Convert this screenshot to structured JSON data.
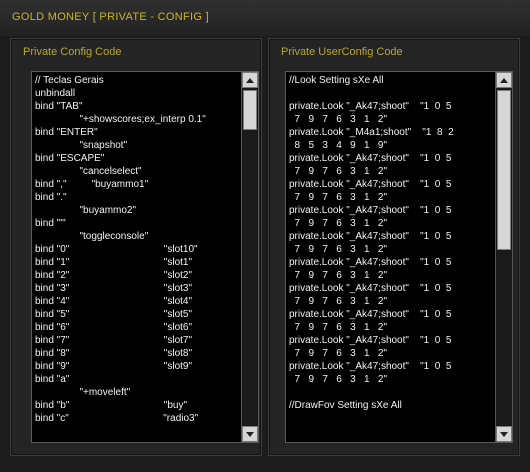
{
  "window": {
    "title": "GOLD MONEY [ PRIVATE - CONFIG ]"
  },
  "left_panel": {
    "title": "Private Config Code",
    "lines": [
      "// Teclas Gerais",
      "unbindall",
      "bind \"TAB\"",
      "                \"+showscores;ex_interp 0.1\"",
      "bind \"ENTER\"",
      "                \"snapshot\"",
      "bind \"ESCAPE\"",
      "                \"cancelselect\"",
      "bind \",\"         \"buyammo1\"",
      "bind \".\"",
      "                \"buyammo2\"",
      "bind \"'\"",
      "                \"toggleconsole\"",
      "bind \"0\"                                  \"slot10\"",
      "bind \"1\"                                  \"slot1\"",
      "bind \"2\"                                  \"slot2\"",
      "bind \"3\"                                  \"slot3\"",
      "bind \"4\"                                  \"slot4\"",
      "bind \"5\"                                  \"slot5\"",
      "bind \"6\"                                  \"slot6\"",
      "bind \"7\"                                  \"slot7\"",
      "bind \"8\"                                  \"slot8\"",
      "bind \"9\"                                  \"slot9\"",
      "bind \"a\"",
      "                \"+moveleft\"",
      "bind \"b\"                                  \"buy\"",
      "bind \"c\"                                  \"radio3\""
    ]
  },
  "right_panel": {
    "title": "Private UserConfig Code",
    "lines": [
      "//Look Setting sXe All",
      "",
      "private.Look \"_Ak47;shoot\"    \"1  0  5",
      "  7   9   7   6   3   1   2\"",
      "private.Look \"_M4a1;shoot\"    \"1  8  2",
      "  8   5   3   4   9   1   9\"",
      "private.Look \"_Ak47;shoot\"    \"1  0  5",
      "  7   9   7   6   3   1   2\"",
      "private.Look \"_Ak47;shoot\"    \"1  0  5",
      "  7   9   7   6   3   1   2\"",
      "private.Look \"_Ak47;shoot\"    \"1  0  5",
      "  7   9   7   6   3   1   2\"",
      "private.Look \"_Ak47;shoot\"    \"1  0  5",
      "  7   9   7   6   3   1   2\"",
      "private.Look \"_Ak47;shoot\"    \"1  0  5",
      "  7   9   7   6   3   1   2\"",
      "private.Look \"_Ak47;shoot\"    \"1  0  5",
      "  7   9   7   6   3   1   2\"",
      "private.Look \"_Ak47;shoot\"    \"1  0  5",
      "  7   9   7   6   3   1   2\"",
      "private.Look \"_Ak47;shoot\"    \"1  0  5",
      "  7   9   7   6   3   1   2\"",
      "private.Look \"_Ak47;shoot\"    \"1  0  5",
      "  7   9   7   6   3   1   2\"",
      "",
      "//DrawFov Setting sXe All"
    ]
  },
  "icons": {
    "scroll_up": "scroll-up-arrow-icon",
    "scroll_down": "scroll-down-arrow-icon"
  },
  "colors": {
    "accent_gold": "#c9b427",
    "background": "#1c1c1c",
    "code_background": "#000000",
    "code_text": "#f2f2f2"
  }
}
